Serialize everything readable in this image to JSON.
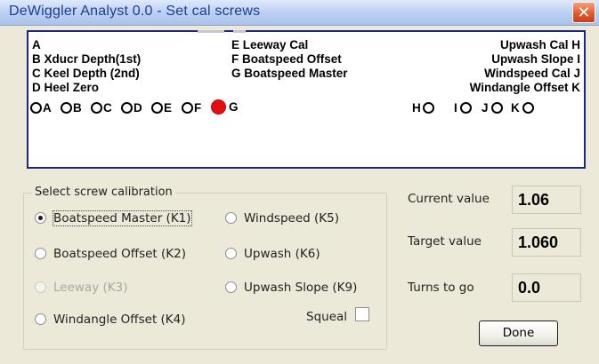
{
  "window": {
    "title": "DeWiggler Analyst 0.0 - Set cal screws",
    "close_glyph": "✕"
  },
  "diagram": {
    "left_labels": [
      "A",
      "B Xducr Depth(1st)",
      "C Keel Depth (2nd)",
      "D Heel Zero"
    ],
    "middle_labels": [
      "E Leeway Cal",
      "F Boatspeed Offset",
      "G Boatspeed Master"
    ],
    "right_labels": [
      "Upwash Cal H",
      "Upwash Slope  I",
      "Windspeed Cal  J",
      "Windangle Offset K"
    ],
    "markers": [
      {
        "letter": "A",
        "selected": false
      },
      {
        "letter": "B",
        "selected": false
      },
      {
        "letter": "C",
        "selected": false
      },
      {
        "letter": "D",
        "selected": false
      },
      {
        "letter": "E",
        "selected": false
      },
      {
        "letter": "F",
        "selected": false
      },
      {
        "letter": "G",
        "selected": true
      },
      {
        "letter": "H",
        "selected": false
      },
      {
        "letter": "I",
        "selected": false
      },
      {
        "letter": "J",
        "selected": false
      },
      {
        "letter": "K",
        "selected": false
      }
    ],
    "selected_color": "#e01010"
  },
  "calibration": {
    "group_label": "Select screw calibration",
    "options": [
      {
        "label": "Boatspeed Master (K1)",
        "checked": true,
        "disabled": false
      },
      {
        "label": "Windspeed (K5)",
        "checked": false,
        "disabled": false
      },
      {
        "label": "Boatspeed Offset (K2)",
        "checked": false,
        "disabled": false
      },
      {
        "label": "Upwash (K6)",
        "checked": false,
        "disabled": false
      },
      {
        "label": "Leeway (K3)",
        "checked": false,
        "disabled": true
      },
      {
        "label": "Upwash Slope (K9)",
        "checked": false,
        "disabled": false
      },
      {
        "label": "Windangle Offset (K4)",
        "checked": false,
        "disabled": false
      }
    ],
    "squeal_label": "Squeal",
    "squeal_checked": false
  },
  "values": {
    "current_label": "Current value",
    "current_value": "1.06",
    "target_label": "Target value",
    "target_value": "1.060",
    "turns_label": "Turns to go",
    "turns_value": "0.0"
  },
  "buttons": {
    "done_label": "Done"
  }
}
